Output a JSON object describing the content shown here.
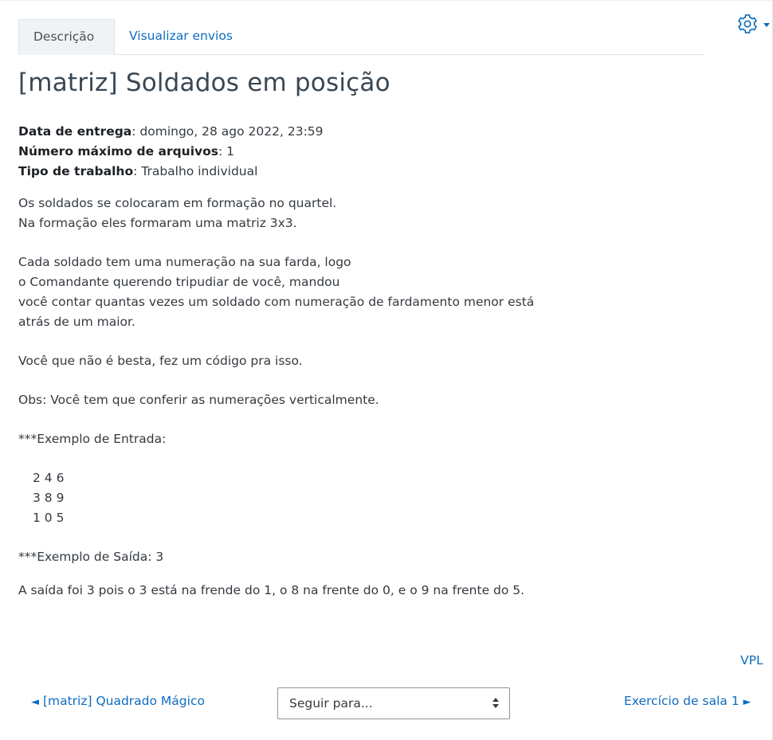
{
  "colors": {
    "link": "#0f6cbf",
    "text": "#343a40",
    "title": "#3a4754",
    "tab_bg": "#f0f3f6"
  },
  "tabs": [
    {
      "label": "Descrição",
      "active": true
    },
    {
      "label": "Visualizar envios",
      "active": false
    }
  ],
  "title": "[matriz] Soldados em posição",
  "meta": {
    "due_label": "Data de entrega",
    "due_value": ": domingo, 28 ago 2022, 23:59",
    "max_files_label": "Número máximo de arquivos",
    "max_files_value": ": 1",
    "work_type_label": "Tipo de trabalho",
    "work_type_value": ": Trabalho individual"
  },
  "description": {
    "p1_l1": "Os soldados se colocaram em formação no quartel.",
    "p1_l2": "Na formação eles formaram uma matriz 3x3.",
    "p2_l1": "Cada soldado tem uma numeração na sua farda, logo",
    "p2_l2": "o Comandante querendo tripudiar de você, mandou",
    "p2_l3": "você contar quantas vezes um soldado com numeração de fardamento menor está",
    "p2_l4": "atrás de um maior.",
    "p3": "Você que não é besta, fez um código pra isso.",
    "p4": "Obs: Você tem que conferir as numerações verticalmente.",
    "example_in_label": "***Exemplo de Entrada:",
    "matrix": [
      "2 4 6",
      "3 8 9",
      "1 0 5"
    ],
    "example_out": "***Exemplo de Saída: 3",
    "explanation": "A saída foi 3 pois o 3 está na frende do 1, o 8 na frente do 0, e o 9 na frente do 5."
  },
  "vpl_link": "VPL",
  "nav": {
    "prev_arrow": "◄",
    "prev_label": "[matriz] Quadrado Mágico",
    "jump_placeholder": "Seguir para...",
    "next_label": "Exercício de sala 1",
    "next_arrow": "►"
  },
  "icons": {
    "settings": "gear-icon",
    "dropdown": "caret-down-icon"
  }
}
